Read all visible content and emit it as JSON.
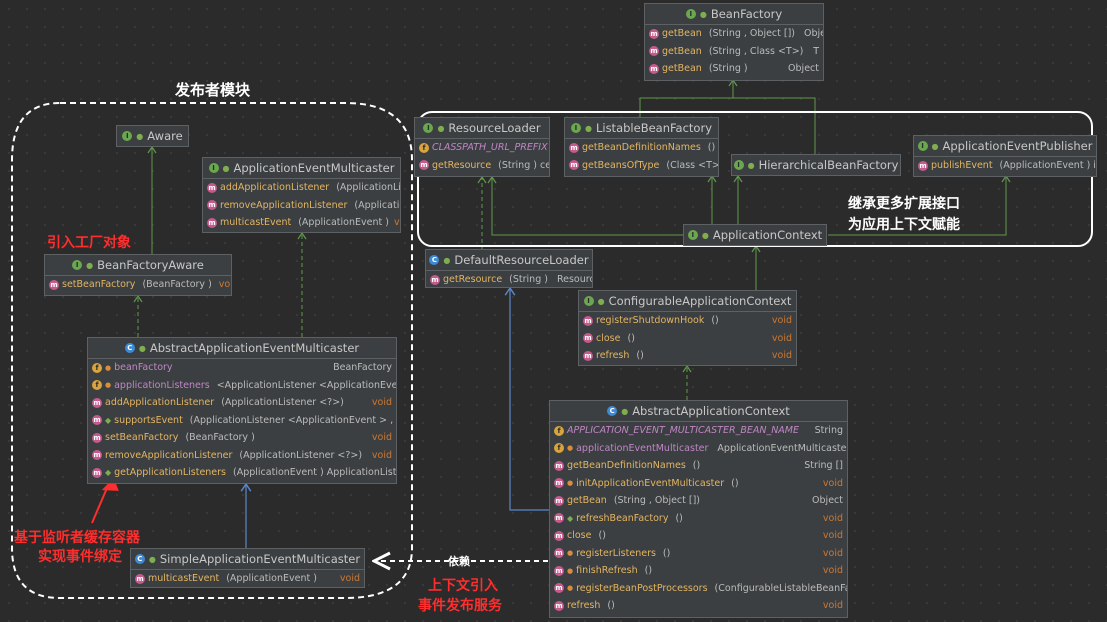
{
  "annotations": {
    "publisher_module": "发布者模块",
    "introduce_factory": "引入工厂对象",
    "listener_cache_1": "基于监听者缓存容器",
    "listener_cache_2": "实现事件绑定",
    "extend_1": "继承更多扩展接口",
    "extend_2": "为应用上下文赋能",
    "dependency": "依赖",
    "context_1": "上下文引入",
    "context_2": "事件发布服务"
  },
  "classes": {
    "bean_factory": {
      "name": "BeanFactory",
      "kind": "I",
      "members": [
        {
          "name": "getBean",
          "params": "(String , Object [])",
          "ret": "Object"
        },
        {
          "name": "getBean",
          "params": "(String , Class <T>)",
          "ret": "T"
        },
        {
          "name": "getBean",
          "params": "(String )",
          "ret": "Object"
        }
      ]
    },
    "resource_loader": {
      "name": "ResourceLoader",
      "kind": "I",
      "members": [
        {
          "name": "CLASSPATH_URL_PREFIX",
          "params": "",
          "ret": ""
        },
        {
          "name": "getResource",
          "params": "(String ) ce",
          "ret": ""
        }
      ]
    },
    "listable_bean_factory": {
      "name": "ListableBeanFactory",
      "kind": "I",
      "members": [
        {
          "name": "getBeanDefinitionNames",
          "params": "()",
          "ret": ""
        },
        {
          "name": "getBeansOfType",
          "params": "(Class <T>)",
          "ret": ""
        }
      ]
    },
    "hierarchical_bean_factory": {
      "name": "HierarchicalBeanFactory",
      "kind": "I"
    },
    "app_event_publisher": {
      "name": "ApplicationEventPublisher",
      "kind": "I",
      "members": [
        {
          "name": "publishEvent",
          "params": "(ApplicationEvent ) id",
          "ret": ""
        }
      ]
    },
    "application_context": {
      "name": "ApplicationContext",
      "kind": "I"
    },
    "default_resource_loader": {
      "name": "DefaultResourceLoader",
      "kind": "C",
      "members": [
        {
          "name": "getResource",
          "params": "(String )",
          "ret": "Resource"
        }
      ]
    },
    "configurable_app_context": {
      "name": "ConfigurableApplicationContext",
      "kind": "I",
      "members": [
        {
          "name": "registerShutdownHook",
          "params": "()",
          "ret": "void"
        },
        {
          "name": "close",
          "params": "()",
          "ret": "void"
        },
        {
          "name": "refresh",
          "params": "()",
          "ret": "void"
        }
      ]
    },
    "abstract_app_context": {
      "name": "AbstractApplicationContext",
      "kind": "C",
      "members": [
        {
          "name": "APPLICATION_EVENT_MULTICASTER_BEAN_NAME",
          "params": "",
          "ret": "String"
        },
        {
          "name": "applicationEventMulticaster",
          "params": "",
          "ret": "ApplicationEventMulticaster"
        },
        {
          "name": "getBeanDefinitionNames",
          "params": "()",
          "ret": "String []"
        },
        {
          "name": "initApplicationEventMulticaster",
          "params": "()",
          "ret": "void"
        },
        {
          "name": "getBean",
          "params": "(String , Object [])",
          "ret": "Object"
        },
        {
          "name": "refreshBeanFactory",
          "params": "()",
          "ret": "void"
        },
        {
          "name": "close",
          "params": "()",
          "ret": "void"
        },
        {
          "name": "registerListeners",
          "params": "()",
          "ret": "void"
        },
        {
          "name": "finishRefresh",
          "params": "()",
          "ret": "void"
        },
        {
          "name": "registerBeanPostProcessors",
          "params": "(ConfigurableListableBeanFactory",
          "ret": ""
        },
        {
          "name": "refresh",
          "params": "()",
          "ret": "void"
        }
      ]
    },
    "aware": {
      "name": "Aware",
      "kind": "I"
    },
    "app_event_multicaster": {
      "name": "ApplicationEventMulticaster",
      "kind": "I",
      "members": [
        {
          "name": "addApplicationListener",
          "params": "(ApplicationListe",
          "ret": ""
        },
        {
          "name": "removeApplicationListener",
          "params": "(Application",
          "ret": ""
        },
        {
          "name": "multicastEvent",
          "params": "(ApplicationEvent )",
          "ret": "void"
        }
      ]
    },
    "bean_factory_aware": {
      "name": "BeanFactoryAware",
      "kind": "I",
      "members": [
        {
          "name": "setBeanFactory",
          "params": "(BeanFactory )",
          "ret": "void"
        }
      ]
    },
    "abstract_app_event_multicaster": {
      "name": "AbstractApplicationEventMulticaster",
      "kind": "C",
      "members": [
        {
          "name": "beanFactory",
          "params": "",
          "ret": "BeanFactory"
        },
        {
          "name": "applicationListeners",
          "params": "<ApplicationListener <ApplicationEvent > >",
          "ret": ""
        },
        {
          "name": "addApplicationListener",
          "params": "(ApplicationListener <?>)",
          "ret": "void"
        },
        {
          "name": "supportsEvent",
          "params": "(ApplicationListener <ApplicationEvent > , Applicati",
          "ret": ""
        },
        {
          "name": "setBeanFactory",
          "params": "(BeanFactory )",
          "ret": "void"
        },
        {
          "name": "removeApplicationListener",
          "params": "(ApplicationListener <?>)",
          "ret": "void"
        },
        {
          "name": "getApplicationListeners",
          "params": "(ApplicationEvent ) ApplicationListener >",
          "ret": ""
        }
      ]
    },
    "simple_app_event_multicaster": {
      "name": "SimpleApplicationEventMulticaster",
      "kind": "C",
      "members": [
        {
          "name": "multicastEvent",
          "params": "(ApplicationEvent )",
          "ret": "void"
        }
      ]
    }
  },
  "colors": {
    "inheritance": "#5f9a4a",
    "extends_class": "#5b87c9",
    "annotation_red": "#ff2e2e"
  }
}
